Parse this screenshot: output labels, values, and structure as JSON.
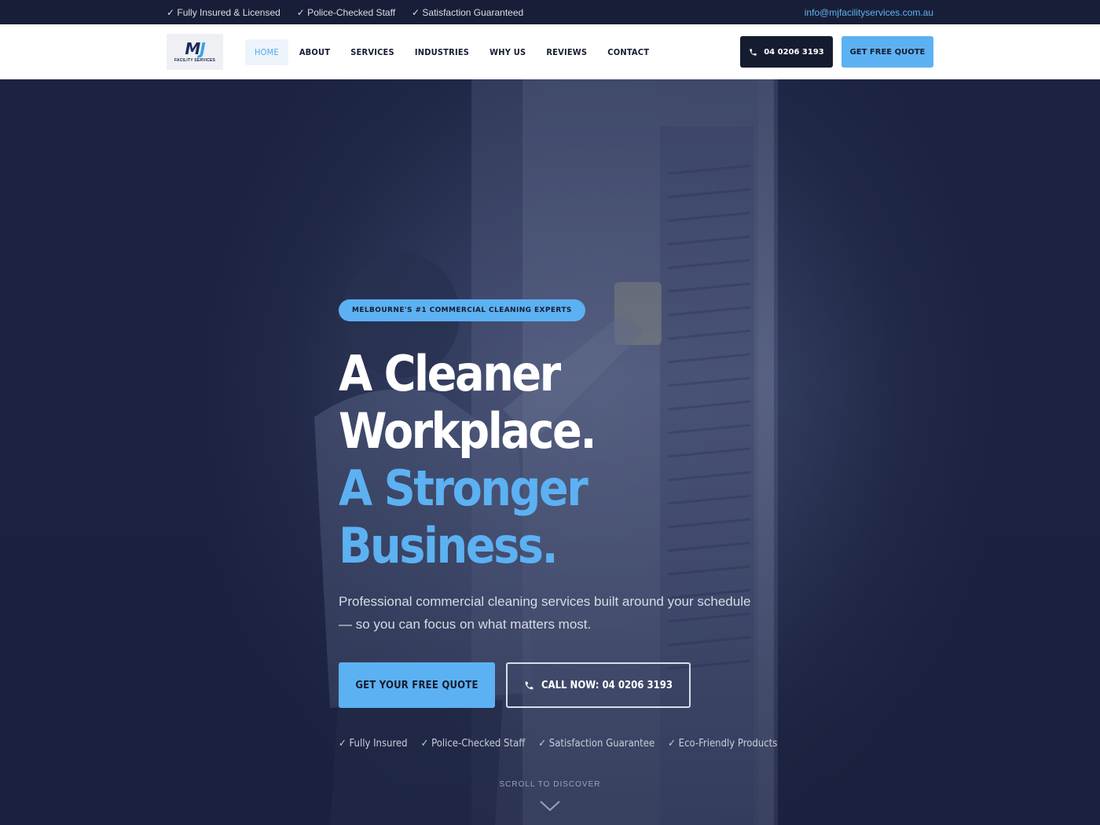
{
  "topbar": {
    "trust_items": [
      "✓ Fully Insured & Licensed",
      "✓ Police-Checked Staff",
      "✓ Satisfaction Guaranteed"
    ],
    "email": "info@mjfacilityservices.com.au"
  },
  "header": {
    "logo": {
      "mark_m": "M",
      "mark_j": "J",
      "sub": "FACILITY SERVICES"
    },
    "nav": [
      "HOME",
      "ABOUT",
      "SERVICES",
      "INDUSTRIES",
      "WHY US",
      "REVIEWS",
      "CONTACT"
    ],
    "active_nav": "HOME",
    "phone_label": "04 0206 3193",
    "quote_label": "GET FREE QUOTE"
  },
  "hero": {
    "badge": "MELBOURNE'S #1 COMMERCIAL CLEANING EXPERTS",
    "headline_line1": "A Cleaner Workplace.",
    "headline_line2": "A Stronger Business.",
    "lead": "Professional commercial cleaning services built around your schedule — so you can focus on what matters most.",
    "cta_primary": "GET YOUR FREE QUOTE",
    "cta_secondary": "CALL NOW: 04 0206 3193",
    "trust_items": [
      "✓ Fully Insured",
      "✓ Police-Checked Staff",
      "✓ Satisfaction Guarantee",
      "✓ Eco-Friendly Products"
    ],
    "scroll_label": "SCROLL TO DISCOVER"
  },
  "colors": {
    "accent": "#5cb1f2",
    "dark": "#161c30",
    "topbar": "#181e37"
  }
}
